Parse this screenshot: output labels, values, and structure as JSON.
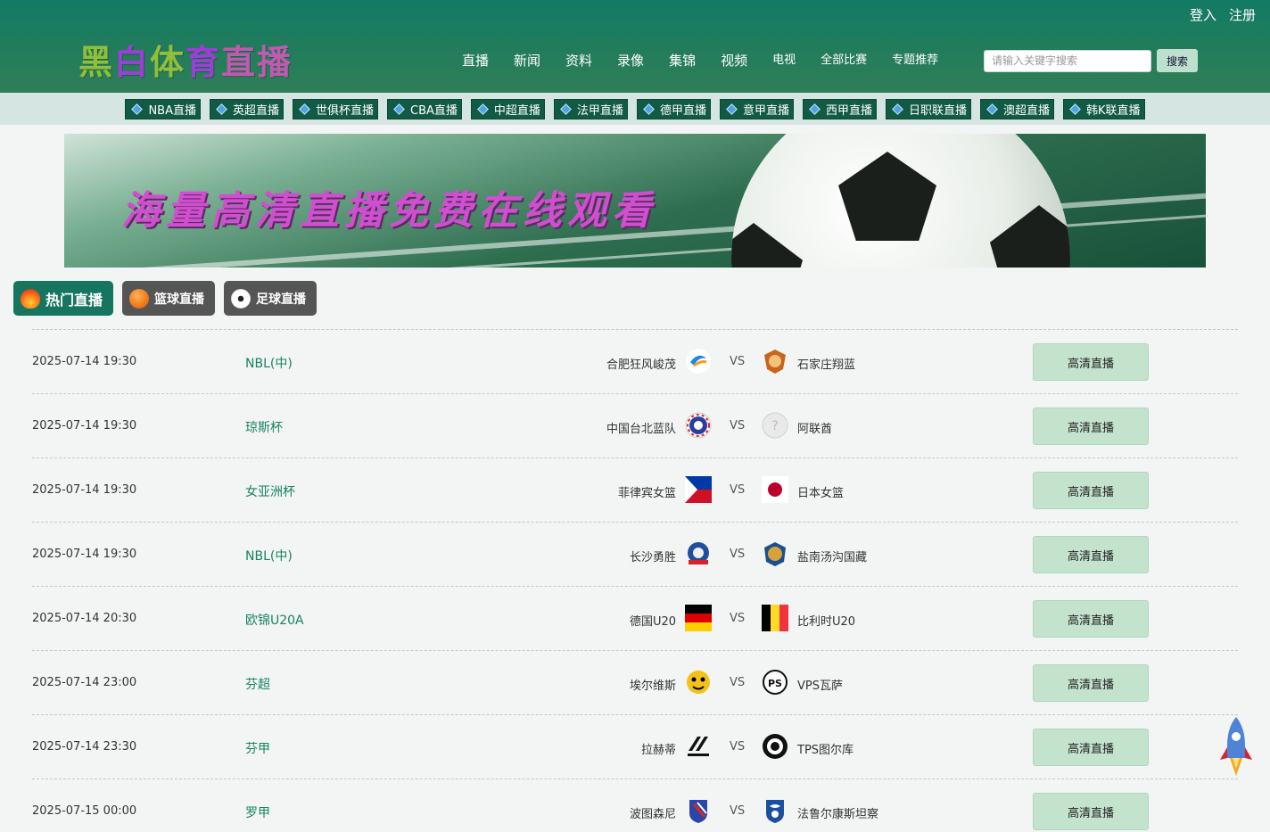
{
  "header": {
    "login": "登入",
    "register": "注册",
    "logo_chars": [
      "黑",
      "白",
      "体",
      "育",
      "直",
      "播"
    ],
    "logo_colors": [
      "#8fbf3c",
      "#9b3fd6",
      "#8fbf3c",
      "#9b3fd6",
      "#c05ab0",
      "#c05ab0"
    ],
    "nav": [
      "直播",
      "新闻",
      "资料",
      "录像",
      "集锦",
      "视频",
      "电视",
      "全部比赛",
      "专题推荐"
    ],
    "search_placeholder": "请输入关键字搜索",
    "search_button": "搜索"
  },
  "leagues": [
    "NBA直播",
    "英超直播",
    "世俱杯直播",
    "CBA直播",
    "中超直播",
    "法甲直播",
    "德甲直播",
    "意甲直播",
    "西甲直播",
    "日职联直播",
    "澳超直播",
    "韩K联直播"
  ],
  "banner": {
    "slogan": "海量高清直播免费在线观看"
  },
  "tabs": [
    {
      "label": "热门直播",
      "icon": "fire-icon",
      "active": true
    },
    {
      "label": "篮球直播",
      "icon": "basketball-icon",
      "active": false
    },
    {
      "label": "足球直播",
      "icon": "soccer-ball-icon",
      "active": false
    }
  ],
  "matches": [
    {
      "time": "2025-07-14 19:30",
      "league": "NBL(中)",
      "home": "合肥狂风峻茂",
      "vs": "VS",
      "away": "石家庄翔蓝",
      "button": "高清直播"
    },
    {
      "time": "2025-07-14 19:30",
      "league": "琼斯杯",
      "home": "中国台北蓝队",
      "vs": "VS",
      "away": "阿联酋",
      "button": "高清直播"
    },
    {
      "time": "2025-07-14 19:30",
      "league": "女亚洲杯",
      "home": "菲律宾女篮",
      "vs": "VS",
      "away": "日本女篮",
      "button": "高清直播"
    },
    {
      "time": "2025-07-14 19:30",
      "league": "NBL(中)",
      "home": "长沙勇胜",
      "vs": "VS",
      "away": "盐南汤沟国藏",
      "button": "高清直播"
    },
    {
      "time": "2025-07-14 20:30",
      "league": "欧锦U20A",
      "home": "德国U20",
      "vs": "VS",
      "away": "比利时U20",
      "button": "高清直播"
    },
    {
      "time": "2025-07-14 23:00",
      "league": "芬超",
      "home": "埃尔维斯",
      "vs": "VS",
      "away": "VPS瓦萨",
      "button": "高清直播"
    },
    {
      "time": "2025-07-14 23:30",
      "league": "芬甲",
      "home": "拉赫蒂",
      "vs": "VS",
      "away": "TPS图尔库",
      "button": "高清直播"
    },
    {
      "time": "2025-07-15 00:00",
      "league": "罗甲",
      "home": "波图森尼",
      "vs": "VS",
      "away": "法鲁尔康斯坦察",
      "button": "高清直播"
    }
  ],
  "colors": {
    "header": "#1d7c5e",
    "accent": "#16755e",
    "league_text": "#168464",
    "watch_button": "#c3e3cd"
  }
}
